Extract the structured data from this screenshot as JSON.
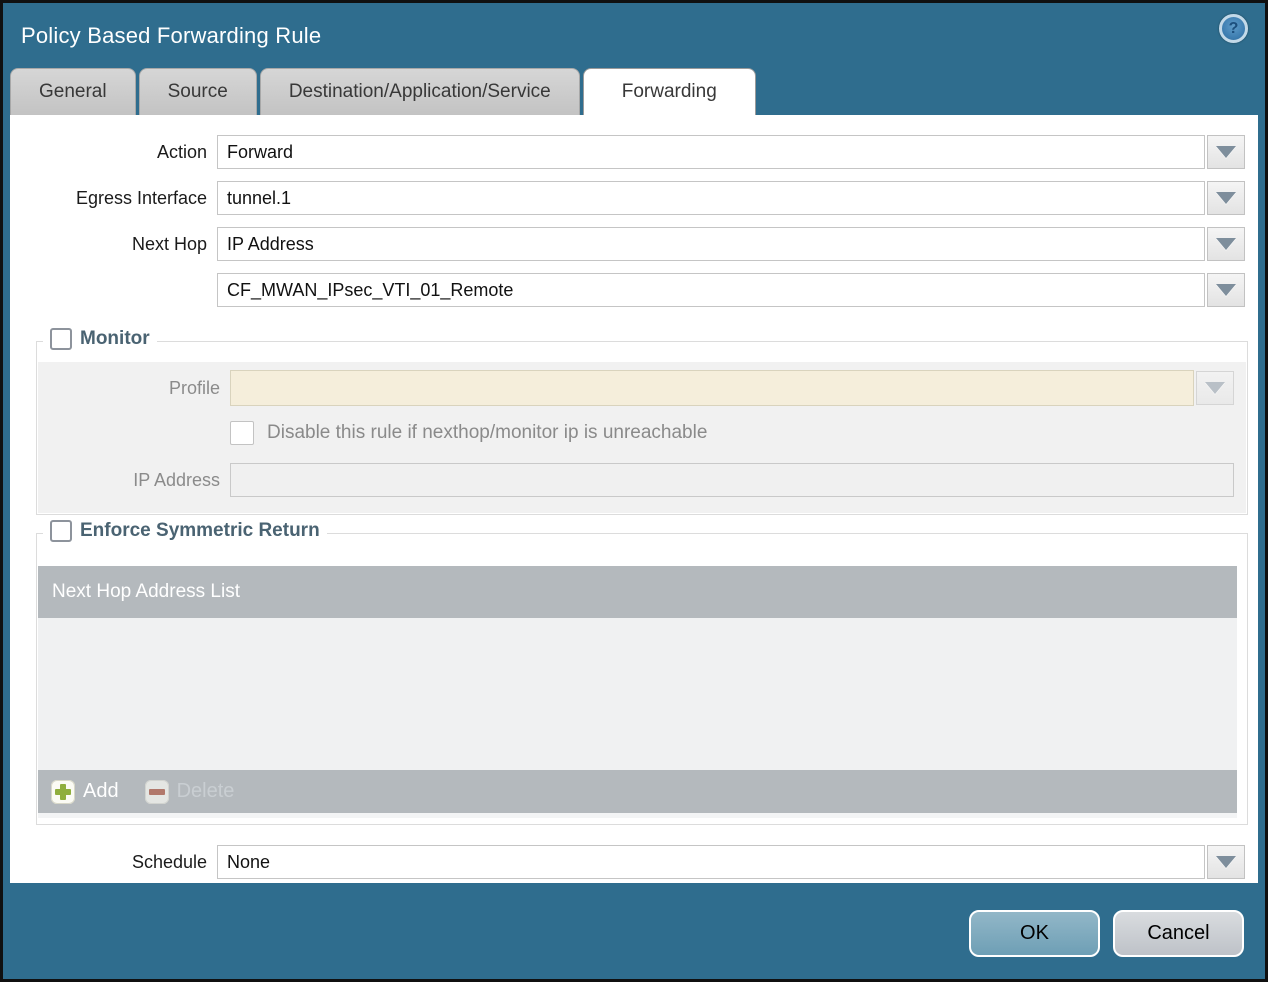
{
  "dialog": {
    "title": "Policy Based Forwarding Rule",
    "help_glyph": "?"
  },
  "tabs": [
    {
      "label": "General",
      "active": false
    },
    {
      "label": "Source",
      "active": false
    },
    {
      "label": "Destination/Application/Service",
      "active": false
    },
    {
      "label": "Forwarding",
      "active": true
    }
  ],
  "form": {
    "action": {
      "label": "Action",
      "value": "Forward"
    },
    "egress_interface": {
      "label": "Egress Interface",
      "value": "tunnel.1"
    },
    "next_hop": {
      "label": "Next Hop",
      "value": "IP Address"
    },
    "next_hop_address": {
      "value": "CF_MWAN_IPsec_VTI_01_Remote"
    },
    "schedule": {
      "label": "Schedule",
      "value": "None"
    }
  },
  "monitor": {
    "legend": "Monitor",
    "checked": false,
    "profile": {
      "label": "Profile",
      "value": ""
    },
    "disable_rule_checkbox": {
      "label": "Disable this rule if nexthop/monitor ip is unreachable",
      "checked": false
    },
    "ip_address": {
      "label": "IP Address",
      "value": ""
    }
  },
  "symmetric_return": {
    "legend": "Enforce Symmetric Return",
    "checked": false,
    "table": {
      "header": "Next Hop Address List",
      "rows": []
    },
    "add_label": "Add",
    "delete_label": "Delete",
    "delete_enabled": false
  },
  "footer": {
    "ok_label": "OK",
    "cancel_label": "Cancel"
  },
  "colors": {
    "titlebar_teal": "#2f6d8e",
    "active_tab": "#ffffff",
    "inactive_tab": "#c8c8c8",
    "disabled_field_beige": "#f5eedb",
    "table_header_gray": "#b4b9bd",
    "table_body_gray": "#f0f1f2",
    "legend_text": "#4a6372",
    "add_icon_green": "#8fae3d",
    "delete_icon_red": "#b1786b",
    "ok_button_blue": "#6e9fb5"
  }
}
